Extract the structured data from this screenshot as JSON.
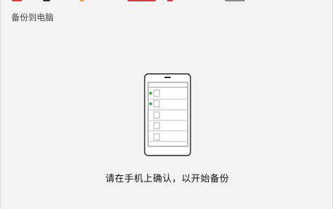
{
  "window": {
    "title": "备份到电脑"
  },
  "main": {
    "message": "请在手机上确认，以开始备份",
    "illustration_icon": "phone-icon"
  },
  "colors": {
    "background": "#f3f3f3",
    "phone_outline": "#222222",
    "list_line": "#bdbdbd",
    "indicator_green": "#2fa82f",
    "top_accent_red": "#e0383e",
    "top_accent_orange": "#f0a030"
  }
}
